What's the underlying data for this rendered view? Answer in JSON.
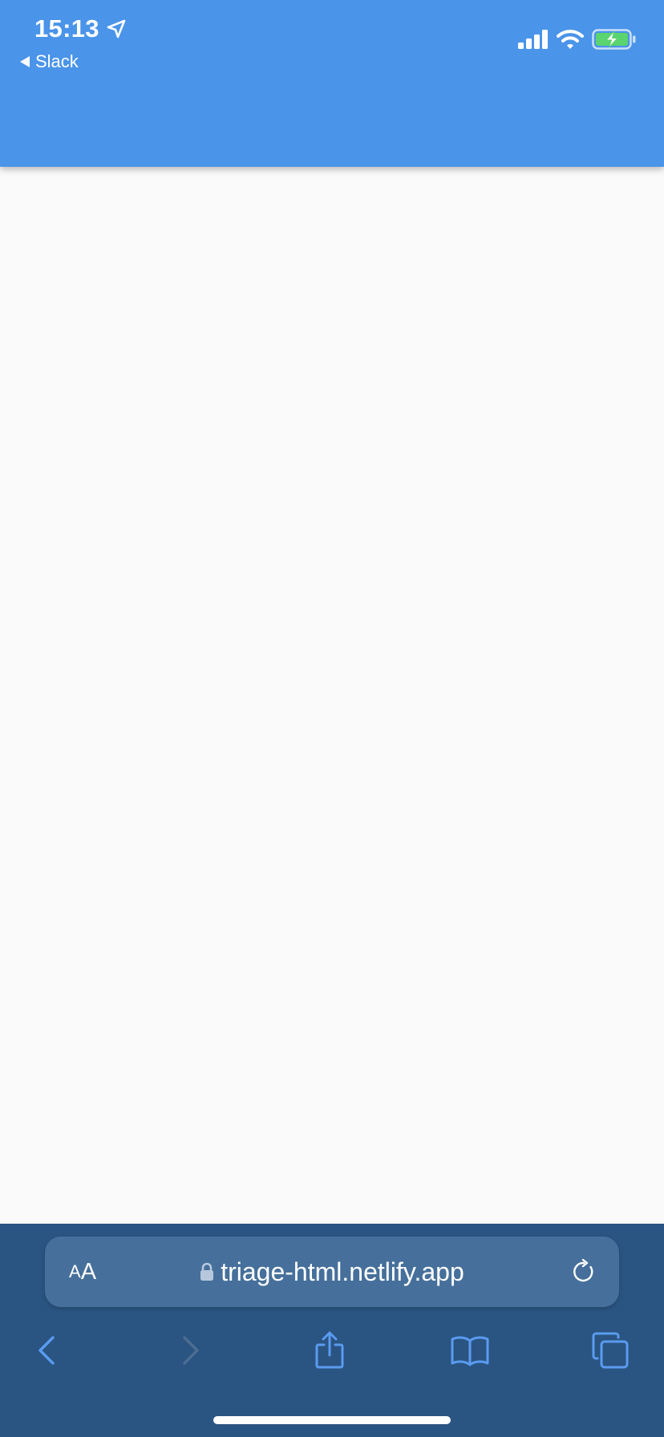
{
  "status_bar": {
    "time": "15:13",
    "back_label": "Slack",
    "battery_color": "#5ad46e"
  },
  "header": {
    "color": "#4a94e9"
  },
  "browser": {
    "aa_label_small": "A",
    "aa_label_large": "A",
    "url": "triage-html.netlify.app",
    "toolbar_icons": [
      "back-icon",
      "forward-icon",
      "share-icon",
      "bookmarks-icon",
      "tabs-icon"
    ],
    "accent_color": "#5a9bf0",
    "bar_color": "#2a5482"
  }
}
